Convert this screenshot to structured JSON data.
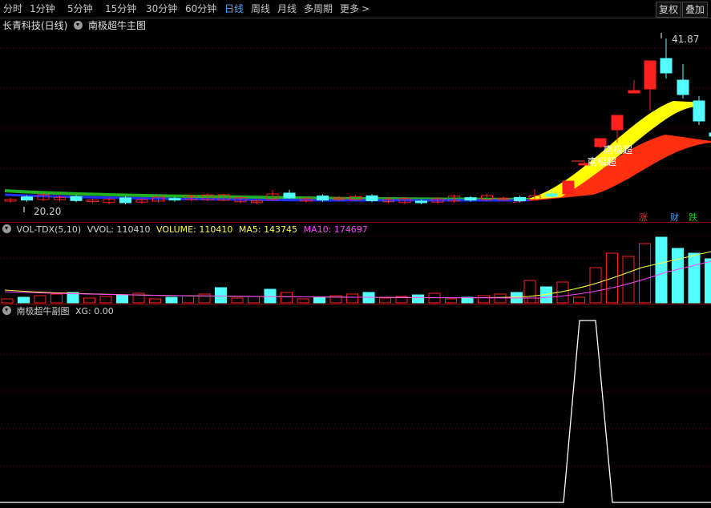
{
  "toolbar": {
    "periods": [
      "分时",
      "1分钟",
      "5分钟",
      "15分钟",
      "30分钟",
      "60分钟",
      "日线",
      "周线",
      "月线",
      "多周期",
      "更多"
    ],
    "active_period": "日线",
    "more_arrow": ">",
    "restore_label": "复权",
    "overlay_label": "叠加"
  },
  "main_panel": {
    "stock_name": "长青科技(日线)",
    "indicator_name": "南极超牛主图",
    "high_label": "41.87",
    "low_label": "20.20",
    "signal_labels": [
      "南极超",
      "南极超"
    ],
    "badges": [
      {
        "text": "涨",
        "color": "#ff3030"
      },
      {
        "text": "财",
        "color": "#3fa0ff"
      },
      {
        "text": "跌",
        "color": "#20c020"
      }
    ]
  },
  "volume_panel": {
    "title": "VOL-TDX(5,10)",
    "vvol_label": "VVOL:",
    "vvol_value": "110410",
    "volume_label": "VOLUME:",
    "volume_value": "110410",
    "ma5_label": "MA5:",
    "ma5_value": "143745",
    "ma10_label": "MA10:",
    "ma10_value": "174697"
  },
  "sub_panel": {
    "title": "南极超牛副图",
    "xg_label": "XG:",
    "xg_value": "0.00"
  },
  "colors": {
    "up": "#ff2020",
    "down": "#54ffff",
    "ma5": "#ffff40",
    "ma10": "#ff40ff",
    "grid": "#7a0000"
  }
}
